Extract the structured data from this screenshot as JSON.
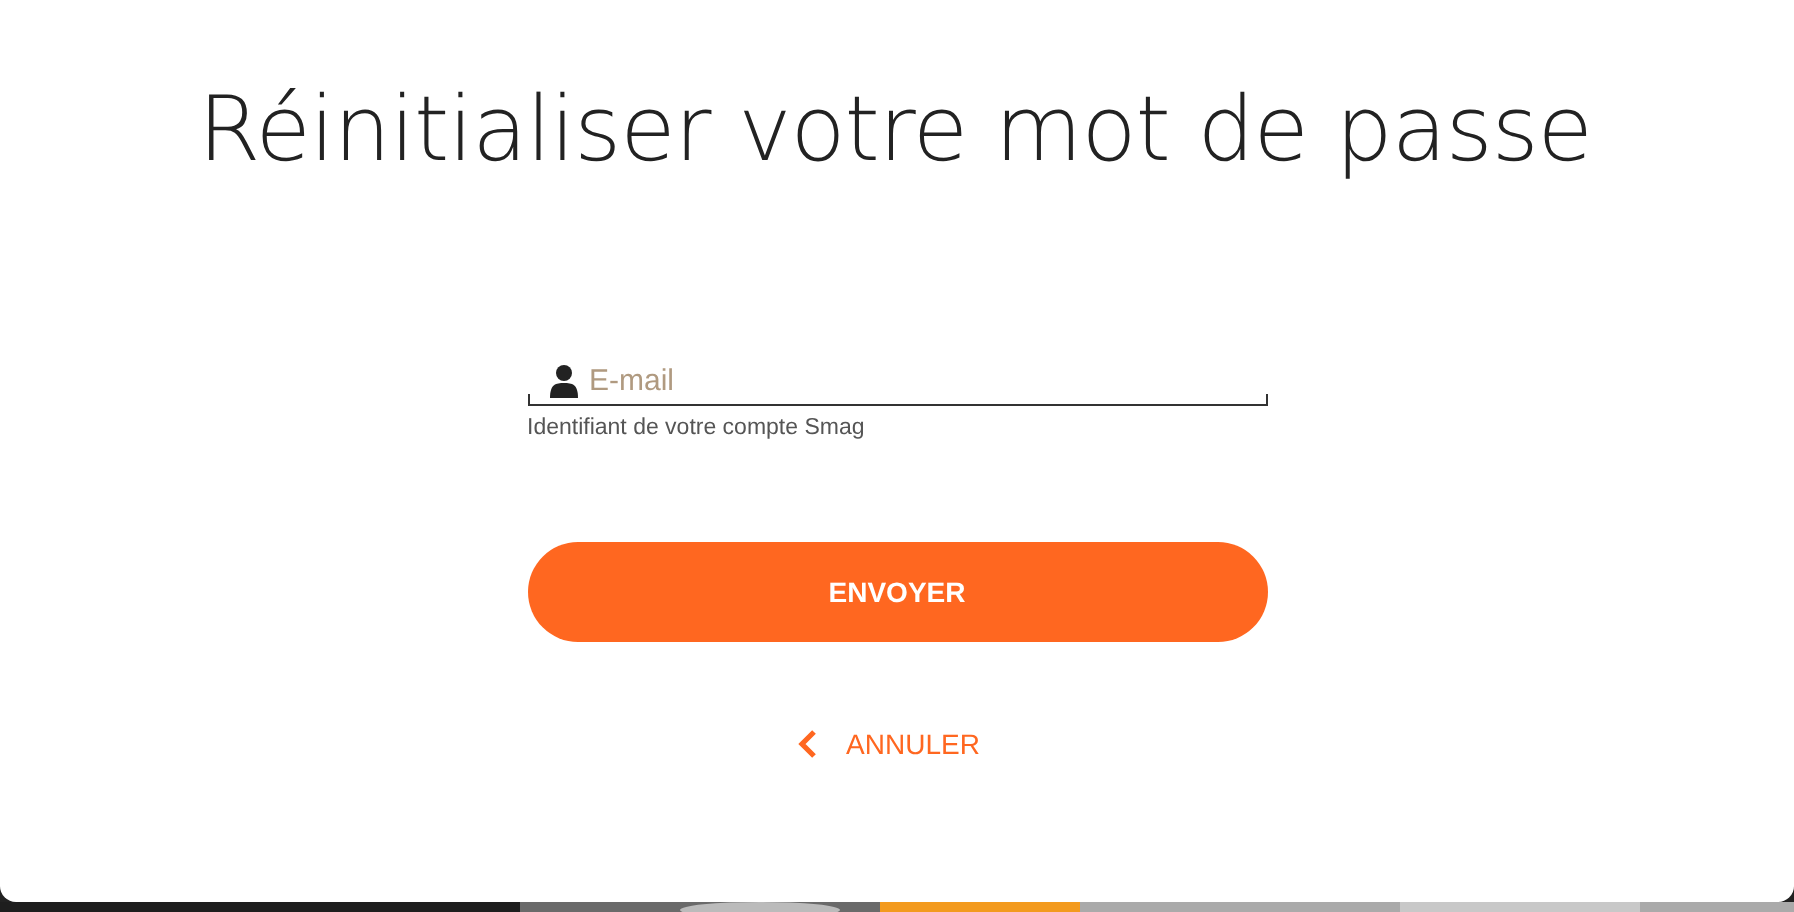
{
  "title": "Réinitialiser votre mot de passe",
  "email_field": {
    "placeholder": "E-mail",
    "hint": "Identifiant de votre compte Smag"
  },
  "submit_button": {
    "label": "ENVOYER"
  },
  "cancel_link": {
    "label": "ANNULER"
  }
}
